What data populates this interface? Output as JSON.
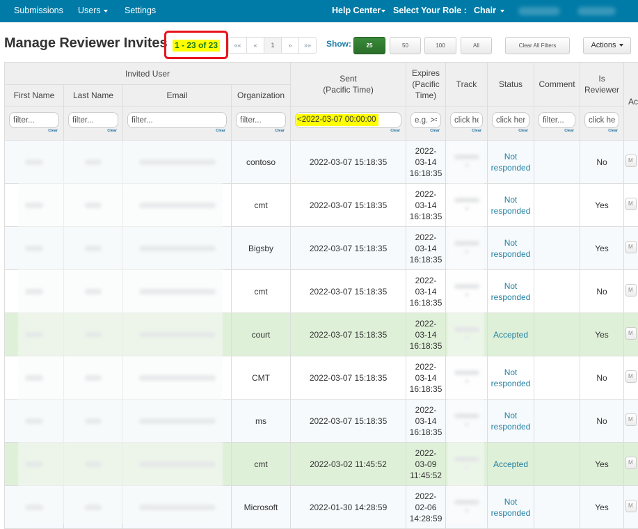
{
  "navbar": {
    "left": [
      {
        "label": "Submissions",
        "has_caret": false
      },
      {
        "label": "Users",
        "has_caret": true
      },
      {
        "label": "Settings",
        "has_caret": false
      }
    ],
    "help_center": "Help Center",
    "role_label": "Select Your Role :",
    "role_value": "Chair",
    "background": "#007ba7"
  },
  "page": {
    "title": "Manage Reviewer Invites",
    "count_label": "1 - 23 of 23",
    "pager": [
      "««",
      "«",
      "1",
      "»",
      "»»"
    ],
    "pager_active": "1",
    "show_label": "Show:",
    "show_options": [
      "25",
      "50",
      "100",
      "All"
    ],
    "show_selected": "25",
    "clear_filters": "Clear All Filters",
    "actions": "Actions"
  },
  "table": {
    "group_header": "Invited User",
    "columns": {
      "first_name": "First Name",
      "last_name": "Last Name",
      "email": "Email",
      "organization": "Organization",
      "sent_line1": "Sent",
      "sent_line2": "(Pacific Time)",
      "expires_line1": "Expires",
      "expires_line2": "(Pacific",
      "expires_line3": "Time)",
      "track": "Track",
      "status": "Status",
      "comment": "Comment",
      "is_reviewer_line1": "Is",
      "is_reviewer_line2": "Reviewer",
      "actions": "Actions"
    },
    "filters": {
      "first_name": {
        "placeholder": "filter...",
        "value": ""
      },
      "last_name": {
        "placeholder": "filter...",
        "value": ""
      },
      "email": {
        "placeholder": "filter...",
        "value": ""
      },
      "organization": {
        "placeholder": "filter...",
        "value": ""
      },
      "sent": {
        "placeholder": "",
        "value": "<2022-03-07 00:00:00"
      },
      "expires": {
        "placeholder": "e.g. >=",
        "value": ""
      },
      "track": {
        "placeholder": "click here",
        "value": ""
      },
      "status": {
        "placeholder": "click here",
        "value": ""
      },
      "comment": {
        "placeholder": "filter...",
        "value": ""
      },
      "is_reviewer": {
        "placeholder": "click here",
        "value": ""
      },
      "clear_label": "Clear"
    },
    "action_button_label": "M",
    "rows": [
      {
        "organization": "contoso",
        "sent": "2022-03-07 15:18:35",
        "expires": [
          "2022-",
          "03-14",
          "16:18:35"
        ],
        "status": [
          "Not",
          "responded"
        ],
        "comment": "",
        "is_reviewer": "No",
        "state": "odd"
      },
      {
        "organization": "cmt",
        "sent": "2022-03-07 15:18:35",
        "expires": [
          "2022-",
          "03-14",
          "16:18:35"
        ],
        "status": [
          "Not",
          "responded"
        ],
        "comment": "",
        "is_reviewer": "Yes",
        "state": "even"
      },
      {
        "organization": "Bigsby",
        "sent": "2022-03-07 15:18:35",
        "expires": [
          "2022-",
          "03-14",
          "16:18:35"
        ],
        "status": [
          "Not",
          "responded"
        ],
        "comment": "",
        "is_reviewer": "Yes",
        "state": "odd"
      },
      {
        "organization": "cmt",
        "sent": "2022-03-07 15:18:35",
        "expires": [
          "2022-",
          "03-14",
          "16:18:35"
        ],
        "status": [
          "Not",
          "responded"
        ],
        "comment": "",
        "is_reviewer": "No",
        "state": "even"
      },
      {
        "organization": "court",
        "sent": "2022-03-07 15:18:35",
        "expires": [
          "2022-",
          "03-14",
          "16:18:35"
        ],
        "status": [
          "Accepted"
        ],
        "comment": "",
        "is_reviewer": "Yes",
        "state": "accepted"
      },
      {
        "organization": "CMT",
        "sent": "2022-03-07 15:18:35",
        "expires": [
          "2022-",
          "03-14",
          "16:18:35"
        ],
        "status": [
          "Not",
          "responded"
        ],
        "comment": "",
        "is_reviewer": "No",
        "state": "even"
      },
      {
        "organization": "ms",
        "sent": "2022-03-07 15:18:35",
        "expires": [
          "2022-",
          "03-14",
          "16:18:35"
        ],
        "status": [
          "Not",
          "responded"
        ],
        "comment": "",
        "is_reviewer": "No",
        "state": "odd"
      },
      {
        "organization": "cmt",
        "sent": "2022-03-02 11:45:52",
        "expires": [
          "2022-",
          "03-09",
          "11:45:52"
        ],
        "status": [
          "Accepted"
        ],
        "comment": "",
        "is_reviewer": "Yes",
        "state": "accepted"
      },
      {
        "organization": "Microsoft",
        "sent": "2022-01-30 14:28:59",
        "expires": [
          "2022-",
          "02-06",
          "14:28:59"
        ],
        "status": [
          "Not",
          "responded"
        ],
        "comment": "",
        "is_reviewer": "Yes",
        "state": "odd"
      }
    ]
  },
  "colors": {
    "navbar": "#007ba7",
    "accent_text": "#1f7da5",
    "active_button": "#2e7d32",
    "accepted_row": "#dff0d8",
    "highlight": "#ffff00",
    "annotation_box": "#e8141c"
  }
}
